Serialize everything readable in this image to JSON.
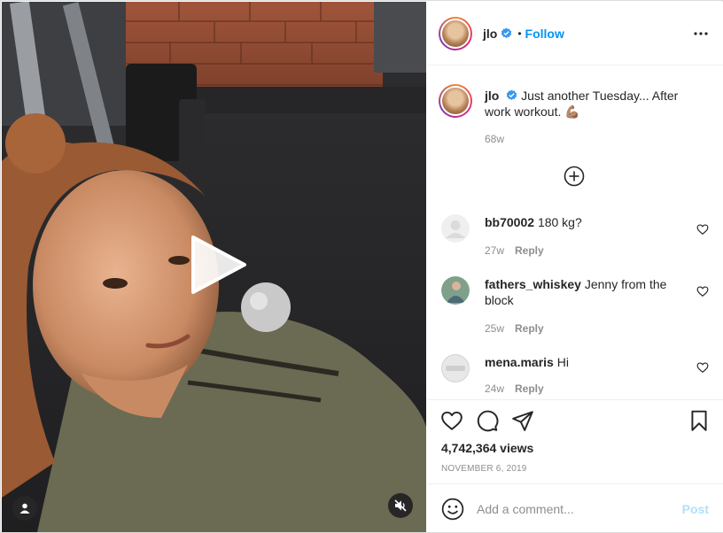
{
  "post": {
    "username": "jlo",
    "follow_label": "Follow",
    "separator": "•",
    "caption_text": "Just another Tuesday... After work workout. 💪🏽",
    "caption_time": "68w",
    "views": "4,742,364 views",
    "date": "NOVEMBER 6, 2019"
  },
  "comments": [
    {
      "username": "bb70002",
      "text": "180 kg?",
      "time": "27w",
      "reply_label": "Reply"
    },
    {
      "username": "fathers_whiskey",
      "text": "Jenny from the block",
      "time": "25w",
      "reply_label": "Reply"
    },
    {
      "username": "mena.maris",
      "text": "Hi",
      "time": "24w",
      "reply_label": "Reply"
    }
  ],
  "add_comment": {
    "placeholder": "Add a comment...",
    "post_label": "Post"
  },
  "icons": {
    "verified": "verified-badge-icon",
    "more": "more-options-icon",
    "load_more": "plus-circle-icon",
    "like": "heart-icon",
    "comment": "comment-icon",
    "share": "paper-plane-icon",
    "save": "bookmark-icon",
    "emoji": "smiley-icon",
    "play": "play-icon",
    "user_tag": "user-icon",
    "mute": "muted-speaker-icon"
  },
  "colors": {
    "link": "#0095f6",
    "post_disabled": "#b2dffc",
    "secondary_text": "#8e8e8e",
    "primary_text": "#262626"
  }
}
